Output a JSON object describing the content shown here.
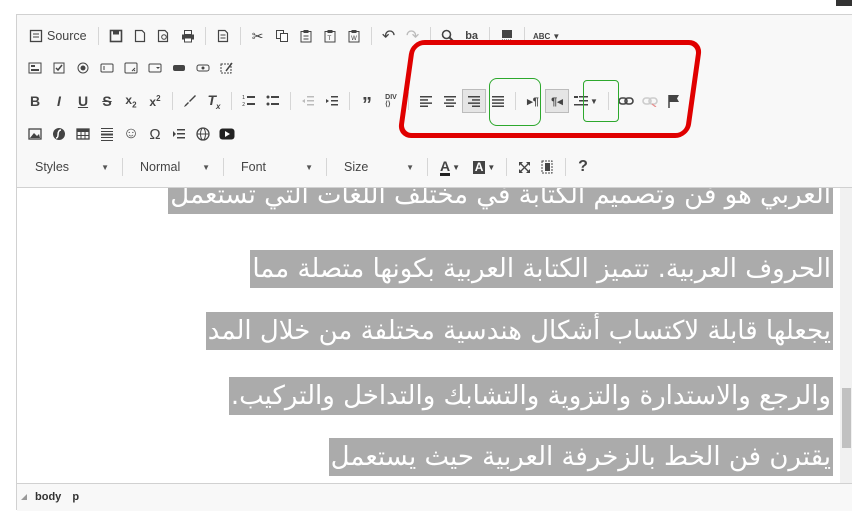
{
  "toolbar": {
    "row1": [
      "source-icon",
      "save-icon",
      "new-page-icon",
      "preview-icon",
      "print-icon",
      "templates-icon",
      "cut-icon",
      "copy-icon",
      "paste-icon",
      "paste-text-icon",
      "paste-word-icon",
      "undo-icon",
      "redo-icon",
      "find-icon",
      "replace-icon",
      "select-all-icon",
      "spellcheck-icon"
    ],
    "source_label": "Source",
    "spell_label": "ABC",
    "styles_label": "Styles",
    "format_label": "Normal",
    "font_label": "Font",
    "size_label": "Size",
    "help_label": "?"
  },
  "content": {
    "lines": [
      "العربي هو فن وتصميم الكتابة في مختلف اللغات التي تستعمل",
      "الحروف العربية. تتميز الكتابة العربية بكونها متصلة مما",
      "يجعلها قابلة لاكتساب أشكال هندسية مختلفة من خلال المد",
      "والرجع والاستدارة والتزوية والتشابك والتداخل والتركيب.",
      "يقترن فن الخط بالزخرفة العربية حيث يستعمل"
    ]
  },
  "statusbar": {
    "path": [
      "body",
      "p"
    ]
  },
  "colors": {
    "selection": "#ababab",
    "annotation_red": "#e00000",
    "annotation_green": "#2da82d"
  }
}
